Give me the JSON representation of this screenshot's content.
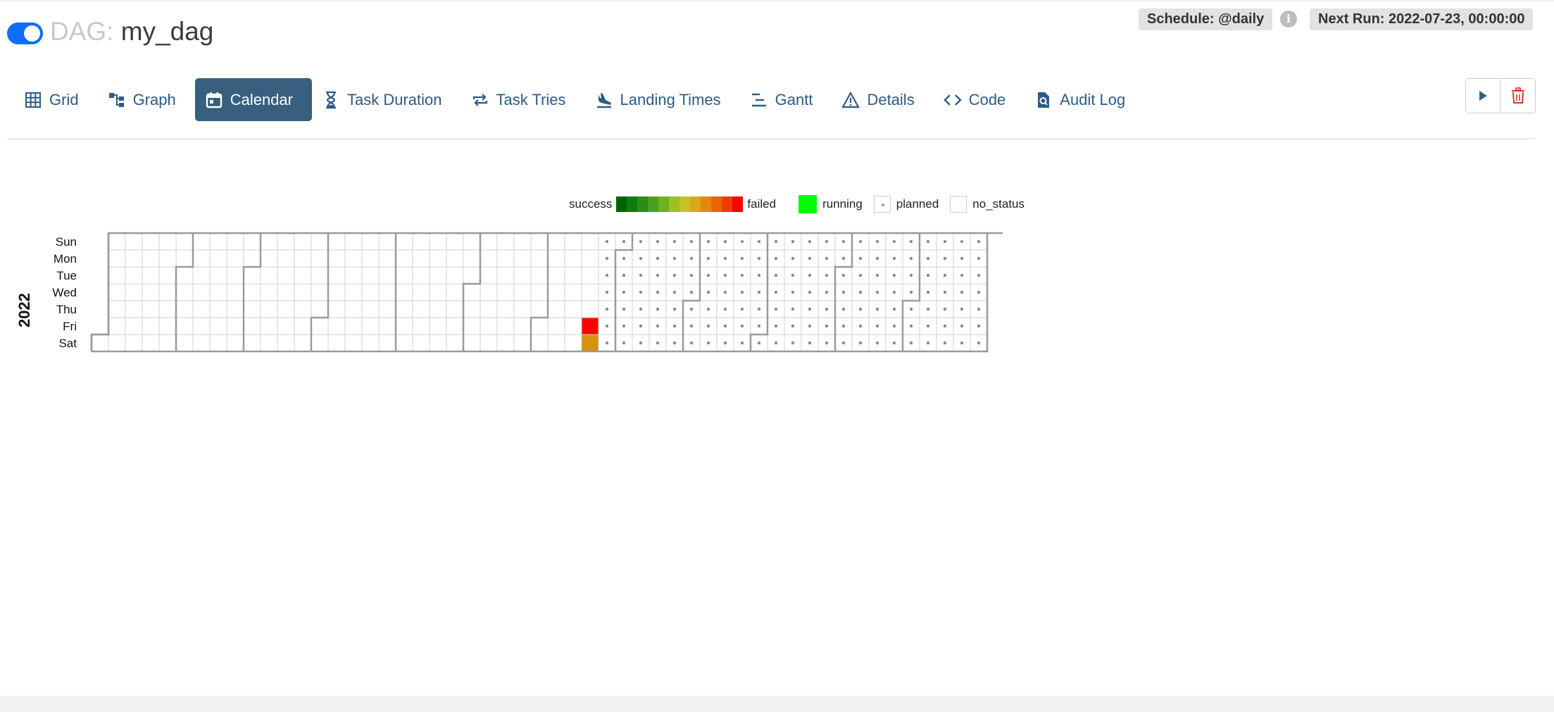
{
  "header": {
    "dag_label": "DAG:",
    "dag_id": "my_dag",
    "schedule": "Schedule: @daily",
    "next_run": "Next Run: 2022-07-23, 00:00:00",
    "paused": false
  },
  "tabs": [
    {
      "label": "Grid",
      "icon": "grid-icon"
    },
    {
      "label": "Graph",
      "icon": "graph-icon"
    },
    {
      "label": "Calendar",
      "icon": "calendar-icon",
      "active": true
    },
    {
      "label": "Task Duration",
      "icon": "hourglass-icon"
    },
    {
      "label": "Task Tries",
      "icon": "repeat-icon"
    },
    {
      "label": "Landing Times",
      "icon": "plane-landing-icon"
    },
    {
      "label": "Gantt",
      "icon": "gantt-icon"
    },
    {
      "label": "Details",
      "icon": "warning-triangle-icon"
    },
    {
      "label": "Code",
      "icon": "code-icon"
    },
    {
      "label": "Audit Log",
      "icon": "file-search-icon"
    }
  ],
  "actions": {
    "trigger": "play-icon",
    "delete": "trash-icon"
  },
  "legend": {
    "success": "success",
    "failed": "failed",
    "running": "running",
    "planned": "planned",
    "no_status": "no_status",
    "gradient": [
      "#006400",
      "#0f7a0f",
      "#2a8e16",
      "#4aa01d",
      "#6fb021",
      "#9cbf25",
      "#c6c224",
      "#d8a917",
      "#e3880e",
      "#ec6408",
      "#f03b06",
      "#ff0000"
    ],
    "running_color": "#00ff00"
  },
  "calendar": {
    "year": "2022",
    "days": [
      "Sun",
      "Mon",
      "Tue",
      "Wed",
      "Thu",
      "Fri",
      "Sat"
    ],
    "year_start_weekday": 6,
    "failed_dates": [
      "2022-07-22"
    ],
    "partial_dates": [
      "2022-07-23"
    ],
    "planned_from": "2022-07-24",
    "failed_color": "#ff0000",
    "partial_color": "#d4920e"
  }
}
